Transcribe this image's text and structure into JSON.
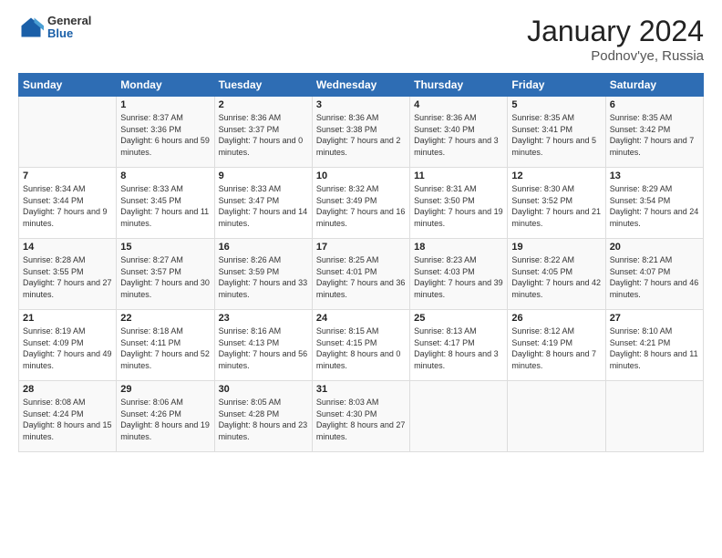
{
  "header": {
    "logo": {
      "general": "General",
      "blue": "Blue"
    },
    "title": "January 2024",
    "subtitle": "Podnov'ye, Russia"
  },
  "calendar": {
    "weekdays": [
      "Sunday",
      "Monday",
      "Tuesday",
      "Wednesday",
      "Thursday",
      "Friday",
      "Saturday"
    ],
    "weeks": [
      [
        {
          "day": "",
          "sunrise": "",
          "sunset": "",
          "daylight": ""
        },
        {
          "day": "1",
          "sunrise": "Sunrise: 8:37 AM",
          "sunset": "Sunset: 3:36 PM",
          "daylight": "Daylight: 6 hours and 59 minutes."
        },
        {
          "day": "2",
          "sunrise": "Sunrise: 8:36 AM",
          "sunset": "Sunset: 3:37 PM",
          "daylight": "Daylight: 7 hours and 0 minutes."
        },
        {
          "day": "3",
          "sunrise": "Sunrise: 8:36 AM",
          "sunset": "Sunset: 3:38 PM",
          "daylight": "Daylight: 7 hours and 2 minutes."
        },
        {
          "day": "4",
          "sunrise": "Sunrise: 8:36 AM",
          "sunset": "Sunset: 3:40 PM",
          "daylight": "Daylight: 7 hours and 3 minutes."
        },
        {
          "day": "5",
          "sunrise": "Sunrise: 8:35 AM",
          "sunset": "Sunset: 3:41 PM",
          "daylight": "Daylight: 7 hours and 5 minutes."
        },
        {
          "day": "6",
          "sunrise": "Sunrise: 8:35 AM",
          "sunset": "Sunset: 3:42 PM",
          "daylight": "Daylight: 7 hours and 7 minutes."
        }
      ],
      [
        {
          "day": "7",
          "sunrise": "Sunrise: 8:34 AM",
          "sunset": "Sunset: 3:44 PM",
          "daylight": "Daylight: 7 hours and 9 minutes."
        },
        {
          "day": "8",
          "sunrise": "Sunrise: 8:33 AM",
          "sunset": "Sunset: 3:45 PM",
          "daylight": "Daylight: 7 hours and 11 minutes."
        },
        {
          "day": "9",
          "sunrise": "Sunrise: 8:33 AM",
          "sunset": "Sunset: 3:47 PM",
          "daylight": "Daylight: 7 hours and 14 minutes."
        },
        {
          "day": "10",
          "sunrise": "Sunrise: 8:32 AM",
          "sunset": "Sunset: 3:49 PM",
          "daylight": "Daylight: 7 hours and 16 minutes."
        },
        {
          "day": "11",
          "sunrise": "Sunrise: 8:31 AM",
          "sunset": "Sunset: 3:50 PM",
          "daylight": "Daylight: 7 hours and 19 minutes."
        },
        {
          "day": "12",
          "sunrise": "Sunrise: 8:30 AM",
          "sunset": "Sunset: 3:52 PM",
          "daylight": "Daylight: 7 hours and 21 minutes."
        },
        {
          "day": "13",
          "sunrise": "Sunrise: 8:29 AM",
          "sunset": "Sunset: 3:54 PM",
          "daylight": "Daylight: 7 hours and 24 minutes."
        }
      ],
      [
        {
          "day": "14",
          "sunrise": "Sunrise: 8:28 AM",
          "sunset": "Sunset: 3:55 PM",
          "daylight": "Daylight: 7 hours and 27 minutes."
        },
        {
          "day": "15",
          "sunrise": "Sunrise: 8:27 AM",
          "sunset": "Sunset: 3:57 PM",
          "daylight": "Daylight: 7 hours and 30 minutes."
        },
        {
          "day": "16",
          "sunrise": "Sunrise: 8:26 AM",
          "sunset": "Sunset: 3:59 PM",
          "daylight": "Daylight: 7 hours and 33 minutes."
        },
        {
          "day": "17",
          "sunrise": "Sunrise: 8:25 AM",
          "sunset": "Sunset: 4:01 PM",
          "daylight": "Daylight: 7 hours and 36 minutes."
        },
        {
          "day": "18",
          "sunrise": "Sunrise: 8:23 AM",
          "sunset": "Sunset: 4:03 PM",
          "daylight": "Daylight: 7 hours and 39 minutes."
        },
        {
          "day": "19",
          "sunrise": "Sunrise: 8:22 AM",
          "sunset": "Sunset: 4:05 PM",
          "daylight": "Daylight: 7 hours and 42 minutes."
        },
        {
          "day": "20",
          "sunrise": "Sunrise: 8:21 AM",
          "sunset": "Sunset: 4:07 PM",
          "daylight": "Daylight: 7 hours and 46 minutes."
        }
      ],
      [
        {
          "day": "21",
          "sunrise": "Sunrise: 8:19 AM",
          "sunset": "Sunset: 4:09 PM",
          "daylight": "Daylight: 7 hours and 49 minutes."
        },
        {
          "day": "22",
          "sunrise": "Sunrise: 8:18 AM",
          "sunset": "Sunset: 4:11 PM",
          "daylight": "Daylight: 7 hours and 52 minutes."
        },
        {
          "day": "23",
          "sunrise": "Sunrise: 8:16 AM",
          "sunset": "Sunset: 4:13 PM",
          "daylight": "Daylight: 7 hours and 56 minutes."
        },
        {
          "day": "24",
          "sunrise": "Sunrise: 8:15 AM",
          "sunset": "Sunset: 4:15 PM",
          "daylight": "Daylight: 8 hours and 0 minutes."
        },
        {
          "day": "25",
          "sunrise": "Sunrise: 8:13 AM",
          "sunset": "Sunset: 4:17 PM",
          "daylight": "Daylight: 8 hours and 3 minutes."
        },
        {
          "day": "26",
          "sunrise": "Sunrise: 8:12 AM",
          "sunset": "Sunset: 4:19 PM",
          "daylight": "Daylight: 8 hours and 7 minutes."
        },
        {
          "day": "27",
          "sunrise": "Sunrise: 8:10 AM",
          "sunset": "Sunset: 4:21 PM",
          "daylight": "Daylight: 8 hours and 11 minutes."
        }
      ],
      [
        {
          "day": "28",
          "sunrise": "Sunrise: 8:08 AM",
          "sunset": "Sunset: 4:24 PM",
          "daylight": "Daylight: 8 hours and 15 minutes."
        },
        {
          "day": "29",
          "sunrise": "Sunrise: 8:06 AM",
          "sunset": "Sunset: 4:26 PM",
          "daylight": "Daylight: 8 hours and 19 minutes."
        },
        {
          "day": "30",
          "sunrise": "Sunrise: 8:05 AM",
          "sunset": "Sunset: 4:28 PM",
          "daylight": "Daylight: 8 hours and 23 minutes."
        },
        {
          "day": "31",
          "sunrise": "Sunrise: 8:03 AM",
          "sunset": "Sunset: 4:30 PM",
          "daylight": "Daylight: 8 hours and 27 minutes."
        },
        {
          "day": "",
          "sunrise": "",
          "sunset": "",
          "daylight": ""
        },
        {
          "day": "",
          "sunrise": "",
          "sunset": "",
          "daylight": ""
        },
        {
          "day": "",
          "sunrise": "",
          "sunset": "",
          "daylight": ""
        }
      ]
    ]
  }
}
